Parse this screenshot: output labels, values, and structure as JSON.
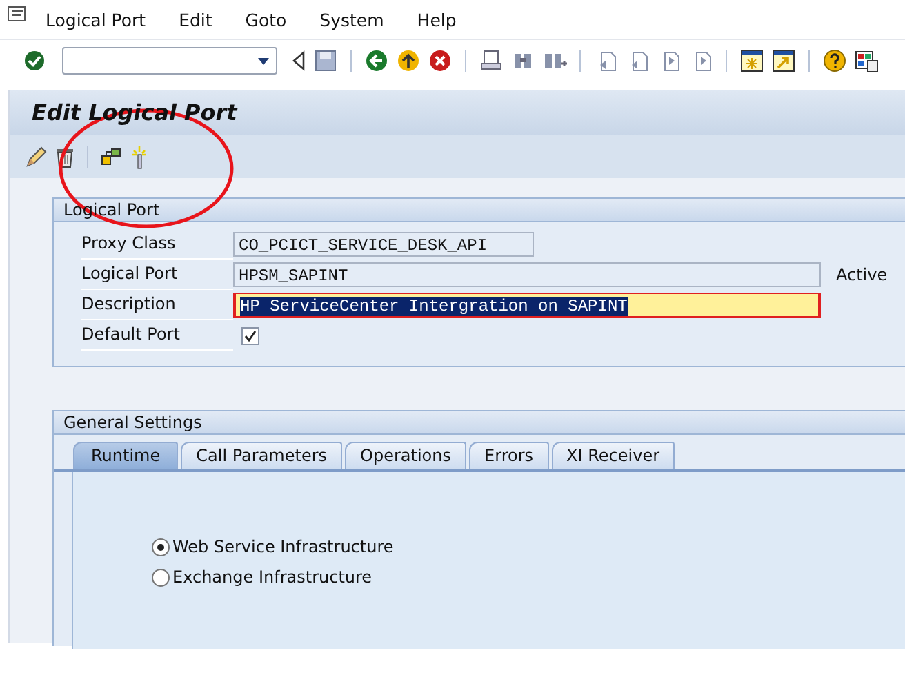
{
  "menu": [
    {
      "label": "Logical Port"
    },
    {
      "label": "Edit"
    },
    {
      "label": "Goto"
    },
    {
      "label": "System"
    },
    {
      "label": "Help"
    }
  ],
  "title": "Edit Logical Port",
  "logical_port": {
    "title": "Logical Port",
    "fields": [
      {
        "kind": "field",
        "label": "Proxy Class",
        "value": "CO_PCICT_SERVICE_DESK_API"
      },
      {
        "kind": "widefield",
        "label": "Logical Port",
        "value": "HPSM_SAPINT",
        "status": "Active"
      },
      {
        "kind": "widefield",
        "label": "Description",
        "value": "HP ServiceCenter Intergration on SAPINT",
        "focused": true
      },
      {
        "kind": "check",
        "label": "Default Port",
        "checked": true
      }
    ]
  },
  "general_settings": {
    "title": "General Settings",
    "tabs": [
      {
        "label": "Runtime",
        "selected": true
      },
      {
        "label": "Call Parameters",
        "selected": false
      },
      {
        "label": "Operations",
        "selected": false
      },
      {
        "label": "Errors",
        "selected": false
      },
      {
        "label": "XI Receiver",
        "selected": false
      }
    ],
    "radios": [
      {
        "label": "Web Service Infrastructure",
        "selected": true
      },
      {
        "label": "Exchange Infrastructure",
        "selected": false
      }
    ]
  }
}
